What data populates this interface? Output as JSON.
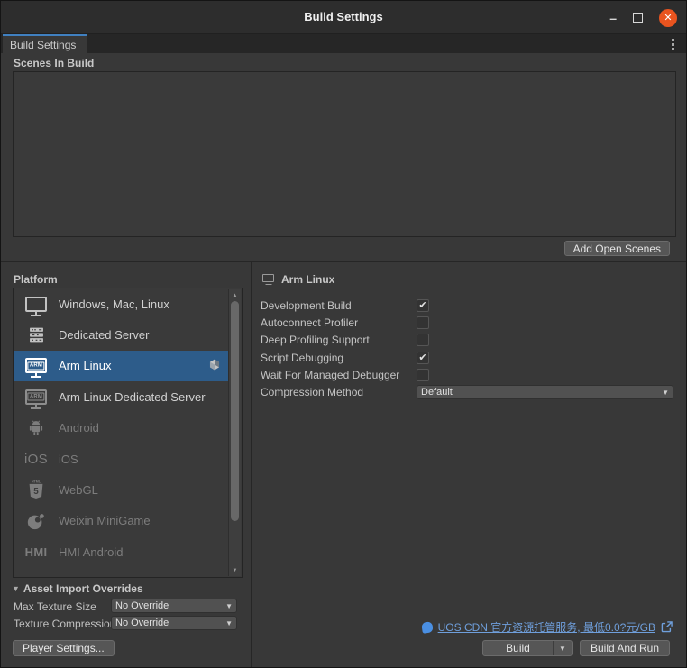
{
  "window": {
    "title": "Build Settings",
    "controls": {
      "minimize": "–",
      "close": "✕"
    }
  },
  "tabbar": {
    "tab_label": "Build Settings"
  },
  "scenes": {
    "label": "Scenes In Build",
    "add_button": "Add Open Scenes"
  },
  "platform": {
    "label": "Platform",
    "items": [
      {
        "name": "Windows, Mac, Linux",
        "icon": "monitor-icon",
        "state": "enabled"
      },
      {
        "name": "Dedicated Server",
        "icon": "server-icon",
        "state": "enabled"
      },
      {
        "name": "Arm Linux",
        "icon": "arm-monitor-icon",
        "icon_label": "ARM",
        "state": "selected",
        "badge": "unity-cube-icon"
      },
      {
        "name": "Arm Linux Dedicated Server",
        "icon": "arm-monitor-icon",
        "icon_label": "ARM",
        "state": "enabled-dim-icon"
      },
      {
        "name": "Android",
        "icon": "android-icon",
        "state": "disabled"
      },
      {
        "name": "iOS",
        "icon": "ios-text-icon",
        "icon_label": "iOS",
        "state": "disabled"
      },
      {
        "name": "WebGL",
        "icon": "html5-icon",
        "icon_label": "5",
        "state": "disabled"
      },
      {
        "name": "Weixin MiniGame",
        "icon": "weixin-icon",
        "state": "disabled"
      },
      {
        "name": "HMI Android",
        "icon": "hmi-text-icon",
        "icon_label": "HMI",
        "state": "disabled"
      }
    ]
  },
  "settings": {
    "header": "Arm Linux",
    "rows": [
      {
        "label": "Development Build",
        "type": "checkbox",
        "checked": true
      },
      {
        "label": "Autoconnect Profiler",
        "type": "checkbox",
        "checked": false
      },
      {
        "label": "Deep Profiling Support",
        "type": "checkbox",
        "checked": false
      },
      {
        "label": "Script Debugging",
        "type": "checkbox",
        "checked": true
      },
      {
        "label": "Wait For Managed Debugger",
        "type": "checkbox",
        "checked": false
      },
      {
        "label": "Compression Method",
        "type": "dropdown",
        "value": "Default"
      }
    ]
  },
  "asset_overrides": {
    "header": "Asset Import Overrides",
    "rows": [
      {
        "label": "Max Texture Size",
        "value": "No Override"
      },
      {
        "label": "Texture Compression",
        "value": "No Override"
      }
    ],
    "player_settings_button": "Player Settings..."
  },
  "footer": {
    "uos_link": "UOS CDN 官方资源托管服务, 最低0.0?元/GB",
    "build_button": "Build",
    "build_and_run_button": "Build And Run"
  },
  "colors": {
    "background": "#383838",
    "titlebar": "#2d2d2d",
    "selection_blue": "#2d5c8a",
    "tab_accent_blue": "#4080c0",
    "close_button_orange": "#e9541f",
    "link_blue": "#6f9fdc"
  }
}
